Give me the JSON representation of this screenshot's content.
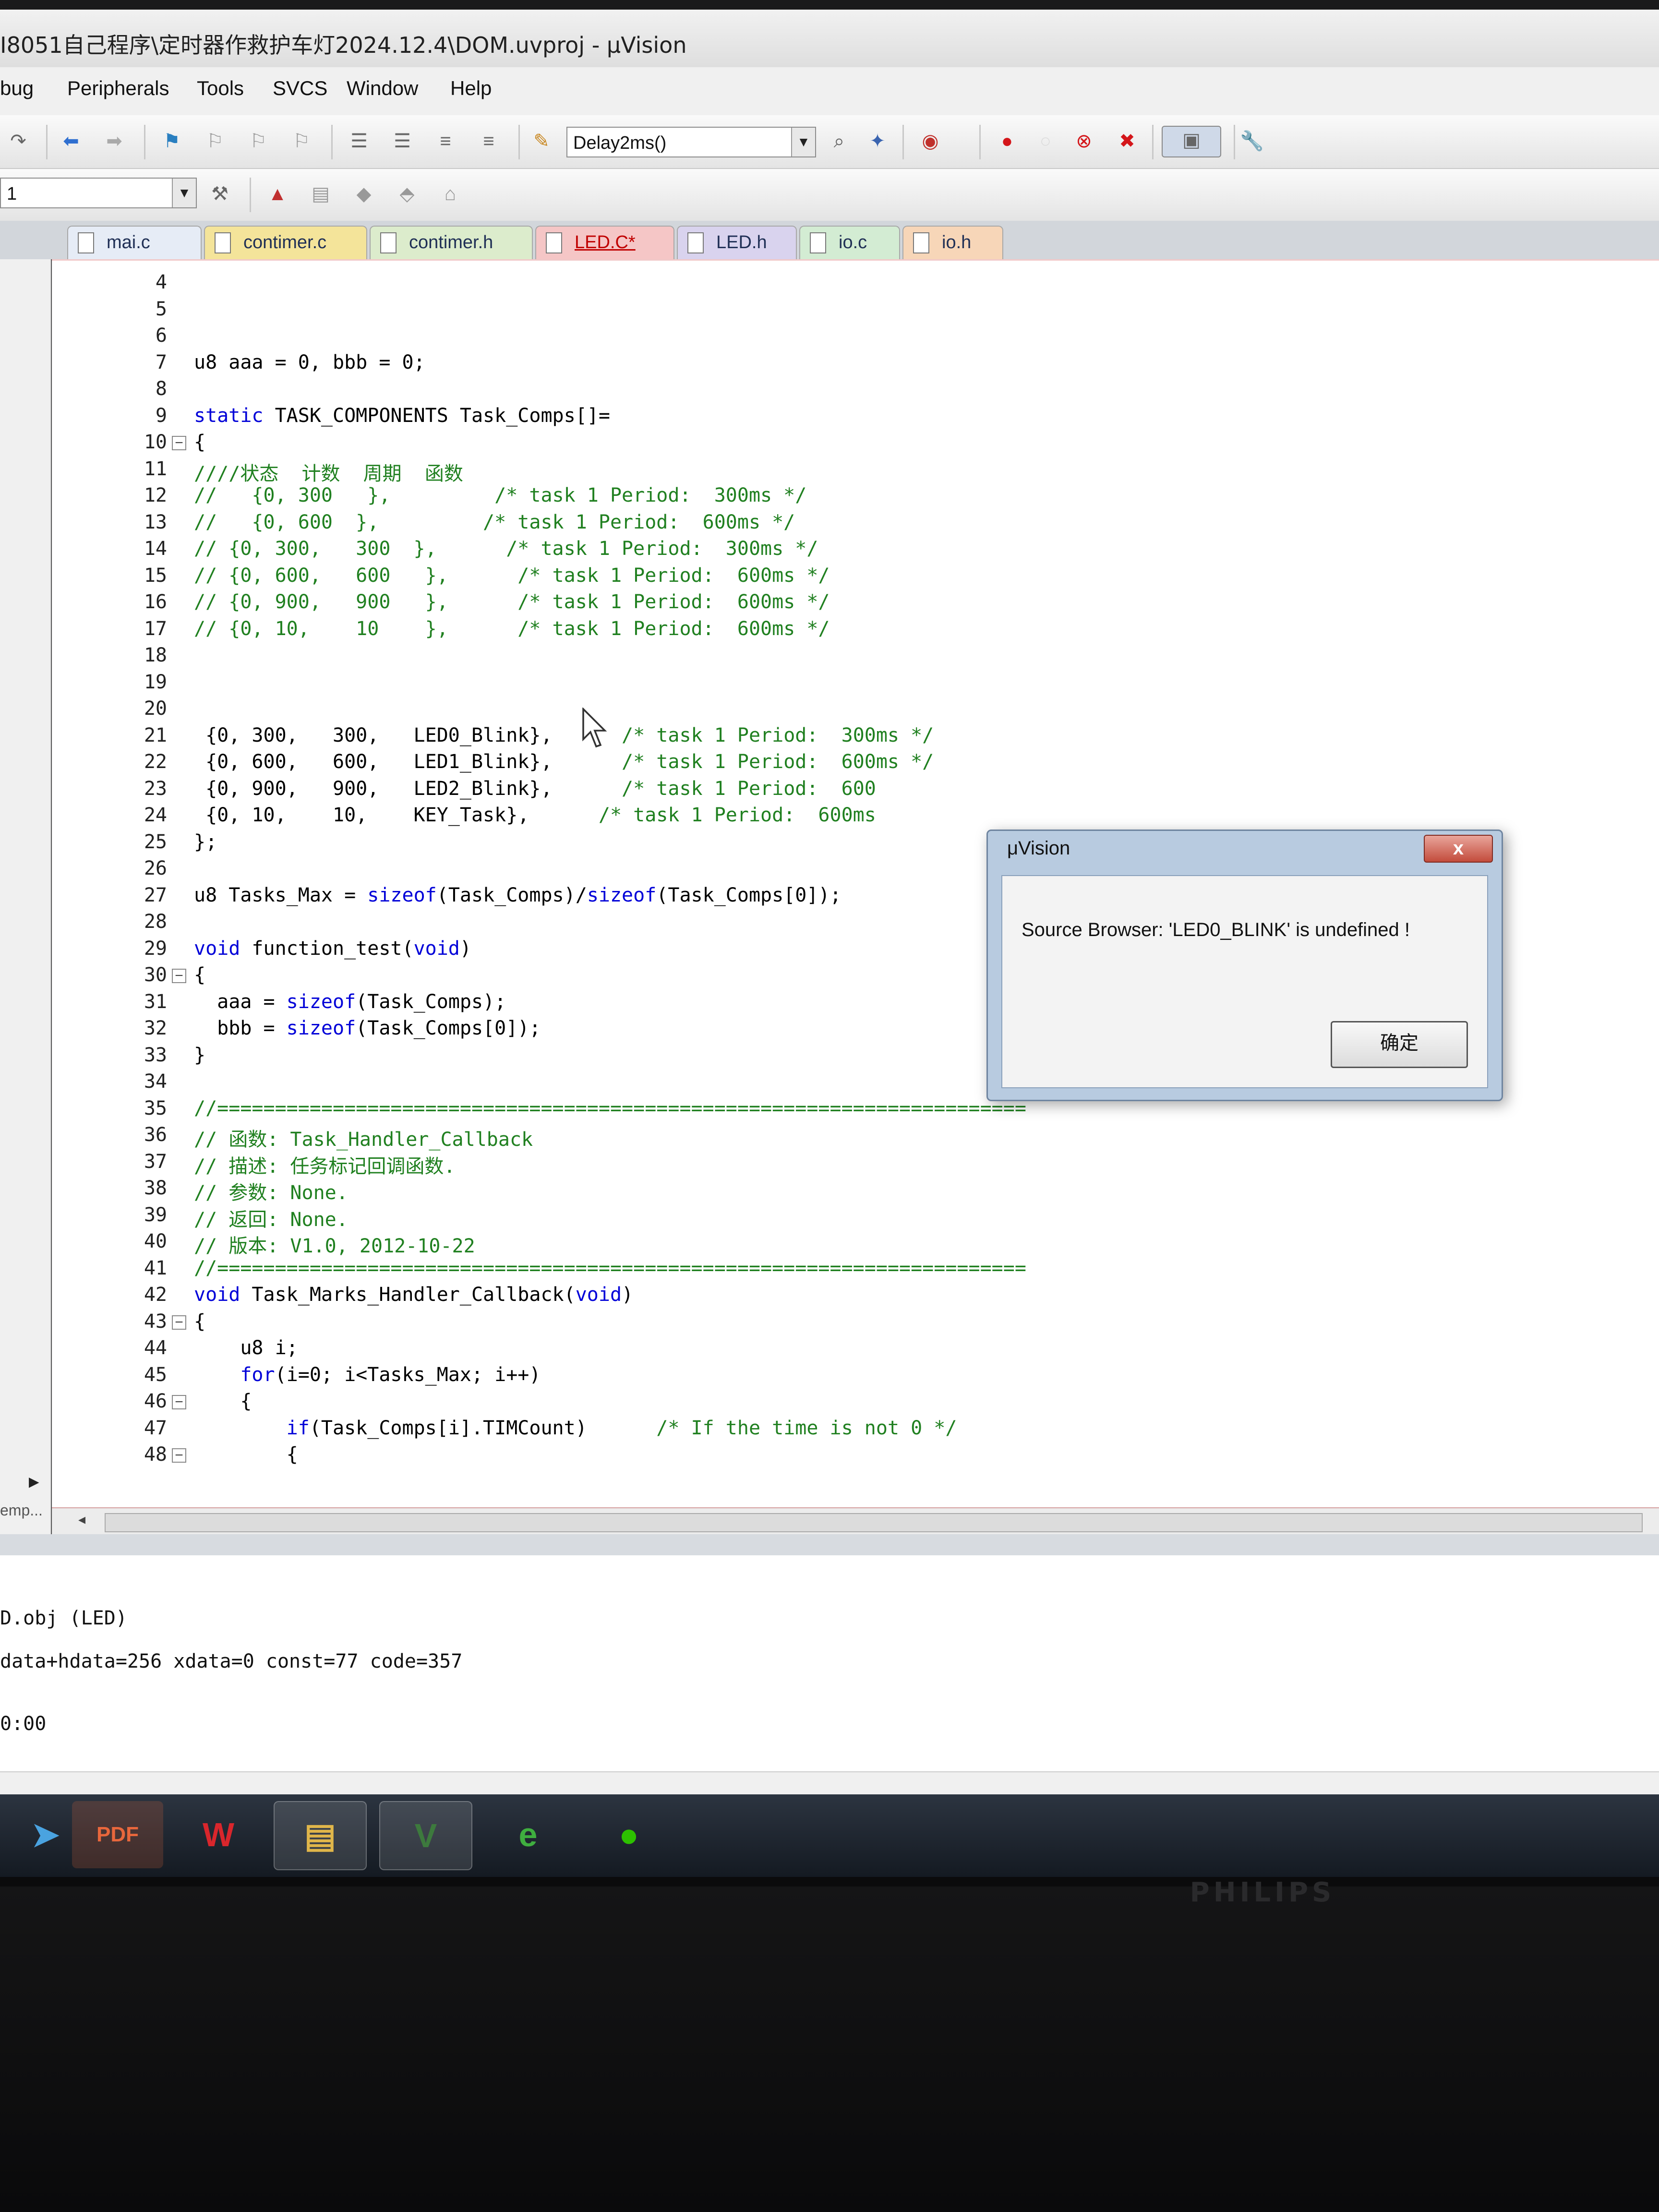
{
  "window": {
    "title": "I8051自己程序\\定时器作救护车灯2024.12.4\\DOM.uvproj - μVision"
  },
  "menu": [
    "bug",
    "Peripherals",
    "Tools",
    "SVCS",
    "Window",
    "Help"
  ],
  "toolbar": {
    "function_combo": "Delay2ms()",
    "target_combo": "1"
  },
  "tabs": [
    {
      "label": "mai.c",
      "color": "#e6ecf6"
    },
    {
      "label": "contimer.c",
      "color": "#f4e49a"
    },
    {
      "label": "contimer.h",
      "color": "#dceccc"
    },
    {
      "label": "LED.C*",
      "color": "#f5c6c6"
    },
    {
      "label": "LED.h",
      "color": "#d9d3ee"
    },
    {
      "label": "io.c",
      "color": "#d3ecd3"
    },
    {
      "label": "io.h",
      "color": "#f7d6b8"
    }
  ],
  "editor": {
    "lines": [
      {
        "n": "4",
        "code": ""
      },
      {
        "n": "5",
        "code": ""
      },
      {
        "n": "6",
        "code": ""
      },
      {
        "n": "7",
        "code": "u8 aaa = 0, bbb = 0;"
      },
      {
        "n": "8",
        "code": ""
      },
      {
        "n": "9",
        "code": "static TASK_COMPONENTS Task_Comps[]="
      },
      {
        "n": "10",
        "code": "{"
      },
      {
        "n": "11",
        "code": "////状态  计数  周期  函数"
      },
      {
        "n": "12",
        "code": "//   {0, 300   },         /* task 1 Period:  300ms */"
      },
      {
        "n": "13",
        "code": "//   {0, 600  },         /* task 1 Period:  600ms */"
      },
      {
        "n": "14",
        "code": "// {0, 300,   300  },      /* task 1 Period:  300ms */"
      },
      {
        "n": "15",
        "code": "// {0, 600,   600   },      /* task 1 Period:  600ms */"
      },
      {
        "n": "16",
        "code": "// {0, 900,   900   },      /* task 1 Period:  600ms */"
      },
      {
        "n": "17",
        "code": "// {0, 10,    10    },      /* task 1 Period:  600ms */"
      },
      {
        "n": "18",
        "code": ""
      },
      {
        "n": "19",
        "code": ""
      },
      {
        "n": "20",
        "code": ""
      },
      {
        "n": "21",
        "code": " {0, 300,   300,   LED0_Blink},      /* task 1 Period:  300ms */"
      },
      {
        "n": "22",
        "code": " {0, 600,   600,   LED1_Blink},      /* task 1 Period:  600ms */"
      },
      {
        "n": "23",
        "code": " {0, 900,   900,   LED2_Blink},      /* task 1 Period:  600"
      },
      {
        "n": "24",
        "code": " {0, 10,    10,    KEY_Task},      /* task 1 Period:  600ms"
      },
      {
        "n": "25",
        "code": "};"
      },
      {
        "n": "26",
        "code": ""
      },
      {
        "n": "27",
        "code": "u8 Tasks_Max = sizeof(Task_Comps)/sizeof(Task_Comps[0]);"
      },
      {
        "n": "28",
        "code": ""
      },
      {
        "n": "29",
        "code": "void function_test(void)"
      },
      {
        "n": "30",
        "code": "{"
      },
      {
        "n": "31",
        "code": "  aaa = sizeof(Task_Comps);"
      },
      {
        "n": "32",
        "code": "  bbb = sizeof(Task_Comps[0]);"
      },
      {
        "n": "33",
        "code": "}"
      },
      {
        "n": "34",
        "code": ""
      },
      {
        "n": "35",
        "code": "//======================================================================"
      },
      {
        "n": "36",
        "code": "// 函数: Task_Handler_Callback"
      },
      {
        "n": "37",
        "code": "// 描述: 任务标记回调函数."
      },
      {
        "n": "38",
        "code": "// 参数: None."
      },
      {
        "n": "39",
        "code": "// 返回: None."
      },
      {
        "n": "40",
        "code": "// 版本: V1.0, 2012-10-22"
      },
      {
        "n": "41",
        "code": "//======================================================================"
      },
      {
        "n": "42",
        "code": "void Task_Marks_Handler_Callback(void)"
      },
      {
        "n": "43",
        "code": "{"
      },
      {
        "n": "44",
        "code": "    u8 i;"
      },
      {
        "n": "45",
        "code": "    for(i=0; i<Tasks_Max; i++)"
      },
      {
        "n": "46",
        "code": "    {"
      },
      {
        "n": "47",
        "code": "        if(Task_Comps[i].TIMCount)      /* If the time is not 0 */"
      },
      {
        "n": "48",
        "code": "        {"
      }
    ]
  },
  "left_panel": {
    "bottom_tab": "emp..."
  },
  "output": {
    "lines": [
      "D.obj (LED)",
      "data+hdata=256 xdata=0 const=77 code=357",
      "0:00"
    ]
  },
  "dialog": {
    "title": "μVision",
    "close_label": "x",
    "message": "Source Browser: 'LED0_BLINK' is undefined !",
    "ok_label": "确定"
  },
  "monitor_brand": "PHILIPS",
  "taskbar": [
    {
      "icon": "bird-icon",
      "glyph": "➤",
      "color": "#4aa3e0"
    },
    {
      "icon": "pdf-icon",
      "glyph": "PDF",
      "color": "#e8673c"
    },
    {
      "icon": "wps-icon",
      "glyph": "W",
      "color": "#d9262c"
    },
    {
      "icon": "file-explorer-icon",
      "glyph": "▤",
      "color": "#e0b64a"
    },
    {
      "icon": "keil-uvision-icon",
      "glyph": "V",
      "color": "#3d7a3d"
    },
    {
      "icon": "ie-browser-icon",
      "glyph": "e",
      "color": "#3fae3f"
    },
    {
      "icon": "wechat-icon",
      "glyph": "●",
      "color": "#2dc100"
    }
  ]
}
